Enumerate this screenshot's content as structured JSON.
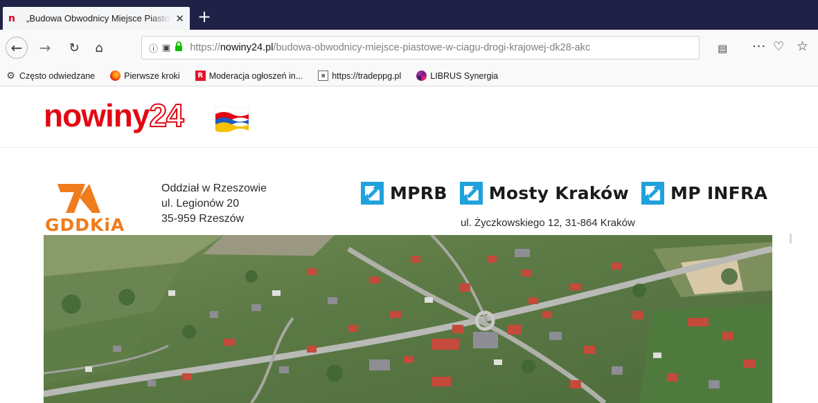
{
  "browser": {
    "tab": {
      "title": "„Budowa Obwodnicy Miejsce Piastowe",
      "favicon": "n",
      "close_glyph": "✕"
    },
    "new_tab_glyph": "+",
    "nav": {
      "back_glyph": "←",
      "forward_glyph": "→",
      "reload_glyph": "↻",
      "home_glyph": "⌂"
    },
    "url": {
      "scheme": "https://",
      "domain": "nowiny24.pl",
      "path": "/budowa-obwodnicy-miejsce-piastowe-w-ciagu-drogi-krajowej-dk28-akc"
    },
    "toolbar": {
      "reader_glyph": "▤",
      "more_glyph": "···",
      "pocket_glyph": "♡",
      "star_glyph": "☆"
    },
    "bookmarks": [
      {
        "icon": "gear-icon",
        "label": "Często odwiedzane"
      },
      {
        "icon": "firefox-icon",
        "label": "Pierwsze kroki"
      },
      {
        "icon": "moderation-icon",
        "label": "Moderacja ogłoszeń in..."
      },
      {
        "icon": "tradeppg-icon",
        "label": "https://tradeppg.pl"
      },
      {
        "icon": "librus-icon",
        "label": "LIBRUS Synergia"
      }
    ]
  },
  "site": {
    "logo_word": "nowiny",
    "logo_number": "24"
  },
  "banner": {
    "gddkia": {
      "name": "GDDKiA",
      "address_lines": [
        "Oddział w Rzeszowie",
        "ul. Legionów 20",
        "35-959 Rzeszów"
      ]
    },
    "brands": [
      "MPRB",
      "Mosty Kraków",
      "MP INFRA"
    ],
    "brands_address": "ul. Życzkowskiego 12, 31-864 Kraków",
    "colors": {
      "gddkia_orange": "#f07c1c",
      "brand_blue": "#1fa2dc",
      "nowiny_red": "#e30613"
    }
  }
}
